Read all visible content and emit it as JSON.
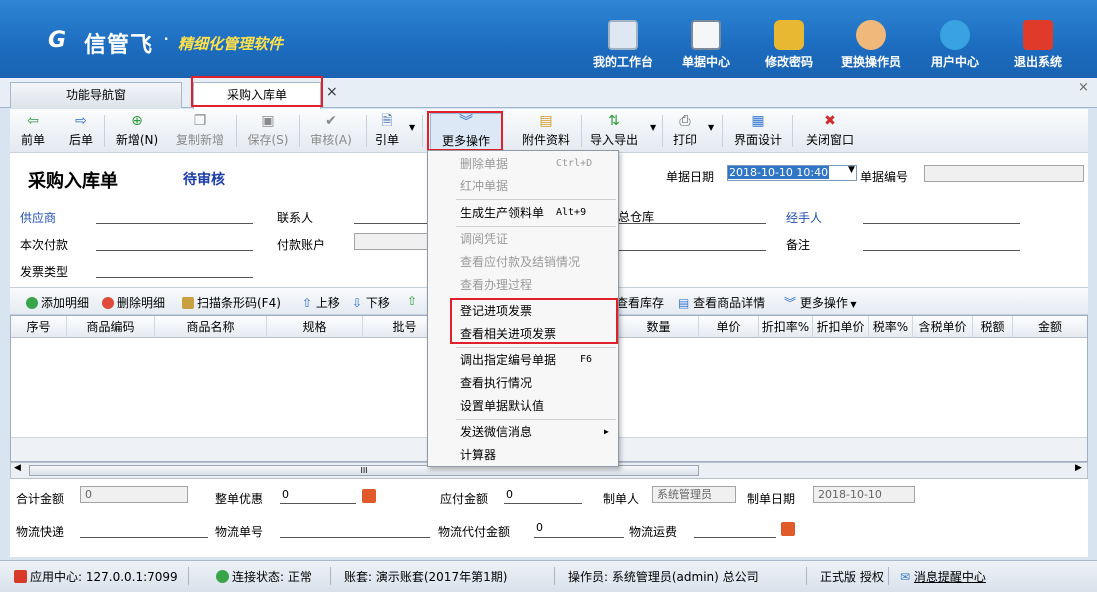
{
  "banner": {
    "logo_mark": "G",
    "brand": "信管飞",
    "dot": "·",
    "slogan": "精细化管理软件",
    "nav": [
      {
        "label": "我的工作台",
        "icon": "monitor-icon"
      },
      {
        "label": "单据中心",
        "icon": "document-list-icon"
      },
      {
        "label": "修改密码",
        "icon": "lock-icon"
      },
      {
        "label": "更换操作员",
        "icon": "user-icon"
      },
      {
        "label": "用户中心",
        "icon": "globe-icon"
      },
      {
        "label": "退出系统",
        "icon": "power-icon"
      }
    ]
  },
  "tabs": {
    "nav_tab": "功能导航窗",
    "active_tab": "采购入库单",
    "close": "×",
    "window_close": "×"
  },
  "toolbar": {
    "prev": "前单",
    "next": "后单",
    "add": "新增(N)",
    "copy_add": "复制新增",
    "save": "保存(S)",
    "audit": "审核(A)",
    "reference": "引单",
    "more": "更多操作",
    "attachments": "附件资料",
    "import_export": "导入导出",
    "print": "打印",
    "ui_design": "界面设计",
    "close_window": "关闭窗口"
  },
  "form": {
    "title": "采购入库单",
    "status": "待审核",
    "date_label": "单据日期",
    "date_value": "2018-10-10 10:40",
    "number_label": "单据编号",
    "supplier": "供应商",
    "contact": "联系人",
    "warehouse_value": "总仓库",
    "handler": "经手人",
    "payment": "本次付款",
    "pay_account": "付款账户",
    "remark": "备注",
    "invoice_type": "发票类型"
  },
  "grid_toolbar": {
    "add_detail": "添加明细",
    "delete_detail": "删除明细",
    "scan_barcode": "扫描条形码(F4)",
    "move_up": "上移",
    "move_down": "下移",
    "view_stock": "查看库存",
    "view_product": "查看商品详情",
    "more": "更多操作"
  },
  "grid": {
    "columns": [
      "序号",
      "商品编码",
      "商品名称",
      "规格",
      "批号",
      "数量",
      "单价",
      "折扣率%",
      "折扣单价",
      "税率%",
      "含税单价",
      "税额",
      "金额"
    ]
  },
  "scrollbar": {
    "thumb_grip": "III"
  },
  "footer": {
    "total_label": "合计金额",
    "total_value": "0",
    "discount_label": "整单优惠",
    "discount_value": "0",
    "payable_label": "应付金额",
    "payable_value": "0",
    "maker_label": "制单人",
    "maker_value": "系统管理员",
    "make_date_label": "制单日期",
    "make_date_value": "2018-10-10",
    "express_label": "物流快递",
    "logistics_no_label": "物流单号",
    "cod_label": "物流代付金额",
    "cod_value": "0",
    "freight_label": "物流运费"
  },
  "statusbar": {
    "app_center": "应用中心: 127.0.0.1:7099",
    "connection": "连接状态: 正常",
    "account": "账套: 演示账套(2017年第1期)",
    "operator": "操作员: 系统管理员(admin) 总公司",
    "edition": "正式版 授权",
    "messages": "消息提醒中心"
  },
  "menu": {
    "items": [
      {
        "label": "删除单据",
        "shortcut": "Ctrl+D",
        "enabled": false
      },
      {
        "label": "红冲单据",
        "shortcut": "",
        "enabled": false
      },
      {
        "label": "生成生产领料单",
        "shortcut": "Alt+9",
        "enabled": true
      },
      {
        "label": "调阅凭证",
        "shortcut": "",
        "enabled": false
      },
      {
        "label": "查看应付款及结销情况",
        "shortcut": "",
        "enabled": false
      },
      {
        "label": "查看办理过程",
        "shortcut": "",
        "enabled": false
      },
      {
        "label": "登记进项发票",
        "shortcut": "",
        "enabled": true
      },
      {
        "label": "查看相关进项发票",
        "shortcut": "",
        "enabled": true
      },
      {
        "label": "调出指定编号单据",
        "shortcut": "F6",
        "enabled": true
      },
      {
        "label": "查看执行情况",
        "shortcut": "",
        "enabled": true
      },
      {
        "label": "设置单据默认值",
        "shortcut": "",
        "enabled": true
      },
      {
        "label": "发送微信消息",
        "shortcut": "",
        "enabled": true
      },
      {
        "label": "计算器",
        "shortcut": "",
        "enabled": true
      }
    ],
    "submenu_arrow": "▶"
  },
  "colors": {
    "accent": "#1c6cc0",
    "highlight": "#e0202a",
    "slogan": "#ffe14a"
  }
}
